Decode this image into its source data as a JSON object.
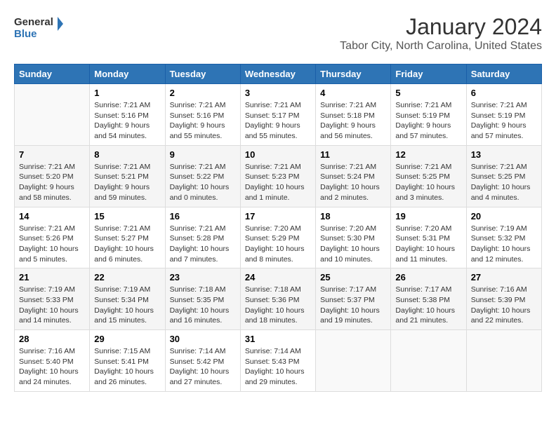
{
  "logo": {
    "line1": "General",
    "line2": "Blue"
  },
  "title": "January 2024",
  "subtitle": "Tabor City, North Carolina, United States",
  "days_of_week": [
    "Sunday",
    "Monday",
    "Tuesday",
    "Wednesday",
    "Thursday",
    "Friday",
    "Saturday"
  ],
  "weeks": [
    [
      {
        "num": "",
        "info": ""
      },
      {
        "num": "1",
        "info": "Sunrise: 7:21 AM\nSunset: 5:16 PM\nDaylight: 9 hours\nand 54 minutes."
      },
      {
        "num": "2",
        "info": "Sunrise: 7:21 AM\nSunset: 5:16 PM\nDaylight: 9 hours\nand 55 minutes."
      },
      {
        "num": "3",
        "info": "Sunrise: 7:21 AM\nSunset: 5:17 PM\nDaylight: 9 hours\nand 55 minutes."
      },
      {
        "num": "4",
        "info": "Sunrise: 7:21 AM\nSunset: 5:18 PM\nDaylight: 9 hours\nand 56 minutes."
      },
      {
        "num": "5",
        "info": "Sunrise: 7:21 AM\nSunset: 5:19 PM\nDaylight: 9 hours\nand 57 minutes."
      },
      {
        "num": "6",
        "info": "Sunrise: 7:21 AM\nSunset: 5:19 PM\nDaylight: 9 hours\nand 57 minutes."
      }
    ],
    [
      {
        "num": "7",
        "info": "Sunrise: 7:21 AM\nSunset: 5:20 PM\nDaylight: 9 hours\nand 58 minutes."
      },
      {
        "num": "8",
        "info": "Sunrise: 7:21 AM\nSunset: 5:21 PM\nDaylight: 9 hours\nand 59 minutes."
      },
      {
        "num": "9",
        "info": "Sunrise: 7:21 AM\nSunset: 5:22 PM\nDaylight: 10 hours\nand 0 minutes."
      },
      {
        "num": "10",
        "info": "Sunrise: 7:21 AM\nSunset: 5:23 PM\nDaylight: 10 hours\nand 1 minute."
      },
      {
        "num": "11",
        "info": "Sunrise: 7:21 AM\nSunset: 5:24 PM\nDaylight: 10 hours\nand 2 minutes."
      },
      {
        "num": "12",
        "info": "Sunrise: 7:21 AM\nSunset: 5:25 PM\nDaylight: 10 hours\nand 3 minutes."
      },
      {
        "num": "13",
        "info": "Sunrise: 7:21 AM\nSunset: 5:25 PM\nDaylight: 10 hours\nand 4 minutes."
      }
    ],
    [
      {
        "num": "14",
        "info": "Sunrise: 7:21 AM\nSunset: 5:26 PM\nDaylight: 10 hours\nand 5 minutes."
      },
      {
        "num": "15",
        "info": "Sunrise: 7:21 AM\nSunset: 5:27 PM\nDaylight: 10 hours\nand 6 minutes."
      },
      {
        "num": "16",
        "info": "Sunrise: 7:21 AM\nSunset: 5:28 PM\nDaylight: 10 hours\nand 7 minutes."
      },
      {
        "num": "17",
        "info": "Sunrise: 7:20 AM\nSunset: 5:29 PM\nDaylight: 10 hours\nand 8 minutes."
      },
      {
        "num": "18",
        "info": "Sunrise: 7:20 AM\nSunset: 5:30 PM\nDaylight: 10 hours\nand 10 minutes."
      },
      {
        "num": "19",
        "info": "Sunrise: 7:20 AM\nSunset: 5:31 PM\nDaylight: 10 hours\nand 11 minutes."
      },
      {
        "num": "20",
        "info": "Sunrise: 7:19 AM\nSunset: 5:32 PM\nDaylight: 10 hours\nand 12 minutes."
      }
    ],
    [
      {
        "num": "21",
        "info": "Sunrise: 7:19 AM\nSunset: 5:33 PM\nDaylight: 10 hours\nand 14 minutes."
      },
      {
        "num": "22",
        "info": "Sunrise: 7:19 AM\nSunset: 5:34 PM\nDaylight: 10 hours\nand 15 minutes."
      },
      {
        "num": "23",
        "info": "Sunrise: 7:18 AM\nSunset: 5:35 PM\nDaylight: 10 hours\nand 16 minutes."
      },
      {
        "num": "24",
        "info": "Sunrise: 7:18 AM\nSunset: 5:36 PM\nDaylight: 10 hours\nand 18 minutes."
      },
      {
        "num": "25",
        "info": "Sunrise: 7:17 AM\nSunset: 5:37 PM\nDaylight: 10 hours\nand 19 minutes."
      },
      {
        "num": "26",
        "info": "Sunrise: 7:17 AM\nSunset: 5:38 PM\nDaylight: 10 hours\nand 21 minutes."
      },
      {
        "num": "27",
        "info": "Sunrise: 7:16 AM\nSunset: 5:39 PM\nDaylight: 10 hours\nand 22 minutes."
      }
    ],
    [
      {
        "num": "28",
        "info": "Sunrise: 7:16 AM\nSunset: 5:40 PM\nDaylight: 10 hours\nand 24 minutes."
      },
      {
        "num": "29",
        "info": "Sunrise: 7:15 AM\nSunset: 5:41 PM\nDaylight: 10 hours\nand 26 minutes."
      },
      {
        "num": "30",
        "info": "Sunrise: 7:14 AM\nSunset: 5:42 PM\nDaylight: 10 hours\nand 27 minutes."
      },
      {
        "num": "31",
        "info": "Sunrise: 7:14 AM\nSunset: 5:43 PM\nDaylight: 10 hours\nand 29 minutes."
      },
      {
        "num": "",
        "info": ""
      },
      {
        "num": "",
        "info": ""
      },
      {
        "num": "",
        "info": ""
      }
    ]
  ]
}
